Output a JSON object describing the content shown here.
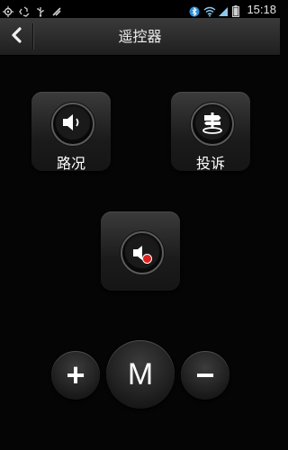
{
  "status_bar": {
    "time": "15:18",
    "left_icons": [
      "gps-icon",
      "recycle-icon",
      "usb-icon",
      "signal-icon"
    ],
    "right_icons": [
      "bluetooth-icon",
      "wifi-icon",
      "cell-signal-icon",
      "battery-icon"
    ]
  },
  "header": {
    "title": "遥控器",
    "back_icon": "chevron-left-icon"
  },
  "buttons": {
    "traffic_label": "路况",
    "complaint_label": "投诉",
    "mute_icon": "speaker-mute-icon"
  },
  "controls": {
    "plus": "+",
    "mode": "M",
    "minus": "−"
  },
  "colors": {
    "background": "#050505",
    "button_dark": "#1b1b1b",
    "mute_badge": "#e02020"
  }
}
